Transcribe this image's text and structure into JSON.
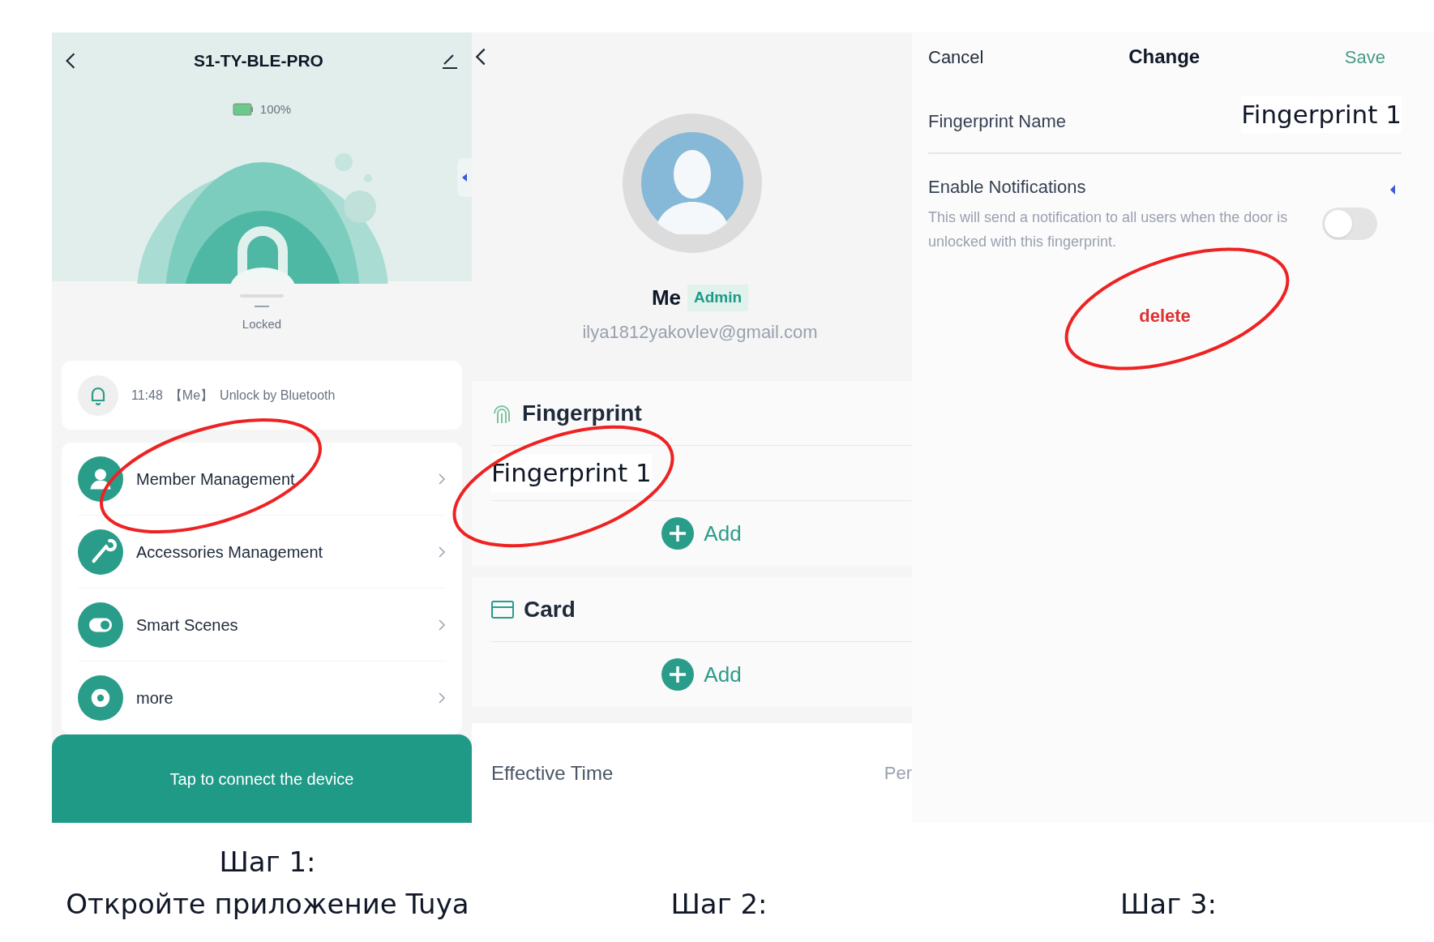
{
  "device_screen": {
    "title": "S1-TY-BLE-PRO",
    "battery": "100%",
    "status": "Locked",
    "event": {
      "time": "11:48",
      "user": "【Me】",
      "action": "Unlock by Bluetooth"
    },
    "menu": [
      {
        "label": "Member Management",
        "kind": "person"
      },
      {
        "label": "Accessories Management",
        "kind": "wrench"
      },
      {
        "label": "Smart Scenes",
        "kind": "toggle"
      },
      {
        "label": "more",
        "kind": "gear"
      }
    ],
    "connect_button": "Tap to connect the device"
  },
  "member_screen": {
    "name": "Me",
    "role": "Admin",
    "email": "ilya1812yakovlev@gmail.com",
    "sections": [
      {
        "title": "Fingerprint",
        "kind": "fingerprint",
        "items": [
          "Fingerprint 1"
        ],
        "add": "Add"
      },
      {
        "title": "Card",
        "kind": "card",
        "add": "Add"
      }
    ],
    "effective_time": {
      "label": "Effective Time",
      "value": "Per"
    }
  },
  "edit_screen": {
    "cancel": "Cancel",
    "title": "Change",
    "save": "Save",
    "name_label": "Fingerprint Name",
    "name_value": "Fingerprint 1",
    "notifications": {
      "label": "Enable Notifications",
      "description": "This will send a notification to all users when the door is unlocked with this fingerprint.",
      "on": false
    },
    "delete": "delete"
  },
  "captions": [
    {
      "lines": [
        "Шаг 1:",
        "Откройте приложение Tuya"
      ]
    },
    {
      "lines": [
        "Шаг 2:"
      ]
    },
    {
      "lines": [
        "Шаг 3:"
      ]
    }
  ]
}
